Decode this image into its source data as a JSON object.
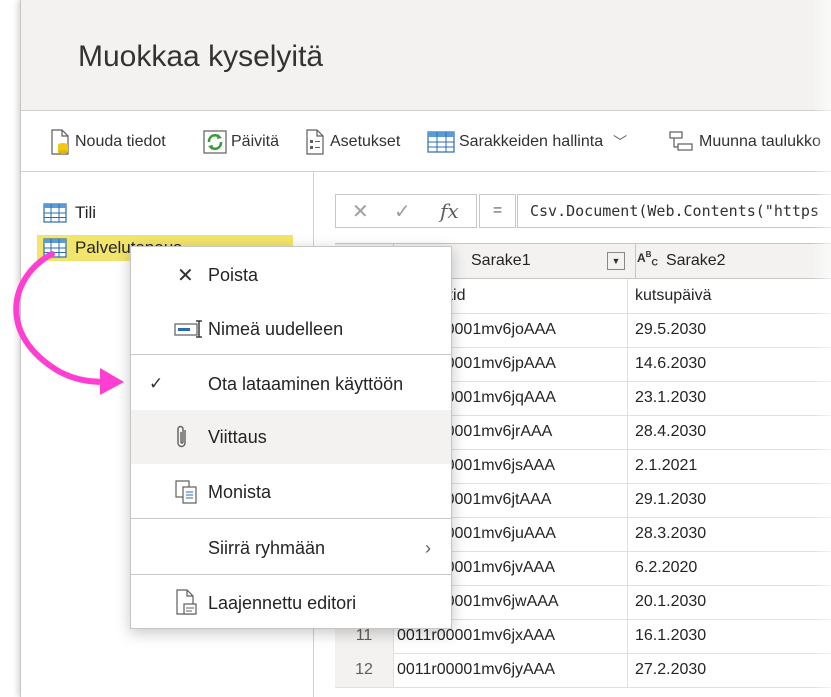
{
  "title": "Muokkaa kyselyitä",
  "ribbon": {
    "get_data": "Nouda tiedot",
    "refresh": "Päivitä",
    "settings": "Asetukset",
    "manage_columns": "Sarakkeiden hallinta",
    "transform_table": "Muunna taulukko"
  },
  "queries": [
    {
      "name": "Tili",
      "icon": "table-icon"
    },
    {
      "name": "Palvelutapaus",
      "icon": "table-icon",
      "selected": true
    }
  ],
  "formula_bar": {
    "cancel": "✕",
    "commit": "✓",
    "fx": "fx",
    "equals": "=",
    "expression": "Csv.Document(Web.Contents(\"https"
  },
  "columns": [
    {
      "type": "ABC",
      "name": "Sarake1"
    },
    {
      "type": "ABC",
      "name": "Sarake2"
    }
  ],
  "rows": [
    {
      "n": "",
      "c1": "accountid",
      "c2": "kutsupäivä"
    },
    {
      "n": "",
      "c1": "0011r00001mv6joAAA",
      "c2": "29.5.2030"
    },
    {
      "n": "",
      "c1": "0011r00001mv6jpAAA",
      "c2": "14.6.2030"
    },
    {
      "n": "",
      "c1": "0011r00001mv6jqAAA",
      "c2": "23.1.2030"
    },
    {
      "n": "",
      "c1": "0011r00001mv6jrAAA",
      "c2": "28.4.2030"
    },
    {
      "n": "",
      "c1": "0011r00001mv6jsAAA",
      "c2": "2.1.2021"
    },
    {
      "n": "",
      "c1": "0011r00001mv6jtAAA",
      "c2": "29.1.2030"
    },
    {
      "n": "",
      "c1": "0011r00001mv6juAAA",
      "c2": "28.3.2030"
    },
    {
      "n": "",
      "c1": "0011r00001mv6jvAAA",
      "c2": "6.2.2020"
    },
    {
      "n": "",
      "c1": "0011r00001mv6jwAAA",
      "c2": "20.1.2030"
    },
    {
      "n": "11",
      "c1": "0011r00001mv6jxAAA",
      "c2": "16.1.2030"
    },
    {
      "n": "12",
      "c1": "0011r00001mv6jyAAA",
      "c2": "27.2.2030"
    }
  ],
  "context_menu": {
    "delete": "Poista",
    "rename": "Nimeä uudelleen",
    "enable_load": "Ota lataaminen käyttöön",
    "enable_load_checked": true,
    "reference": "Viittaus",
    "duplicate": "Monista",
    "move_to_group": "Siirrä ryhmään",
    "advanced_editor": "Laajennettu editori"
  },
  "colors": {
    "selected_query": "#f2e56b",
    "arrow": "#ff3fd2",
    "hover": "#f3f2f1"
  }
}
